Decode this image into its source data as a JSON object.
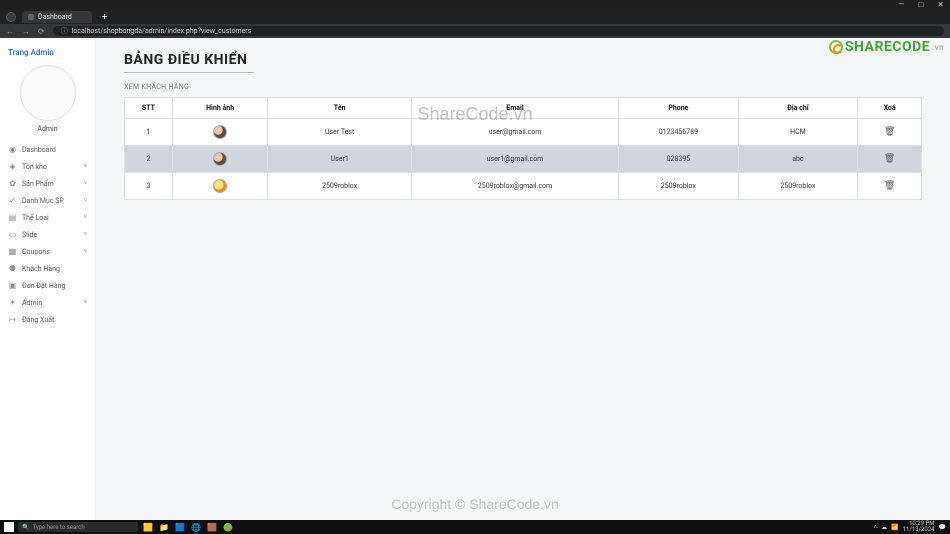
{
  "os": {
    "min": "—",
    "max": "□",
    "close": "✕"
  },
  "browser": {
    "tab_title": "Dashboard",
    "newtab": "+",
    "back": "←",
    "fwd": "→",
    "reload": "⟳",
    "url": "localhost/shopbongda/admin/index.php?view_customers"
  },
  "watermark": {
    "logo_text": "SHARECODE",
    "logo_suffix": ".vn",
    "center": "ShareCode.vn",
    "footer": "Copyright © ShareCode.vn"
  },
  "sidebar": {
    "brand": "Trang Admin",
    "admin_label": "Admin",
    "items": [
      {
        "icon": "◉",
        "label": "Dashboard",
        "chev": ""
      },
      {
        "icon": "◈",
        "label": "Tồn kho",
        "chev": "˅"
      },
      {
        "icon": "✿",
        "label": "Sản Phẩm",
        "chev": "˅"
      },
      {
        "icon": "✓",
        "label": "Danh Mục SP",
        "chev": "˅"
      },
      {
        "icon": "▤",
        "label": "Thể Loại",
        "chev": "˅"
      },
      {
        "icon": "▭",
        "label": "Slide",
        "chev": "˅"
      },
      {
        "icon": "▦",
        "label": "Coupons",
        "chev": "˅"
      },
      {
        "icon": "⚉",
        "label": "Khách Hàng",
        "chev": ""
      },
      {
        "icon": "▣",
        "label": "Đơn Đặt Hàng",
        "chev": ""
      },
      {
        "icon": "✶",
        "label": "Admin",
        "chev": "˅"
      },
      {
        "icon": "↦",
        "label": "Đăng Xuất",
        "chev": ""
      }
    ]
  },
  "page": {
    "title": "BẢNG ĐIỀU KHIỂN",
    "subtitle": "XEM KHÁCH HÀNG"
  },
  "table": {
    "headers": {
      "stt": "STT",
      "img": "Hình ảnh",
      "name": "Tên",
      "email": "Email",
      "phone": "Phone",
      "addr": "Địa chỉ",
      "del": "Xoá"
    },
    "rows": [
      {
        "stt": "1",
        "name": "User Test",
        "email": "user@gmail.com",
        "phone": "0123456789",
        "addr": "HCM",
        "avatar_class": ""
      },
      {
        "stt": "2",
        "name": "User1",
        "email": "user1@gmail.com",
        "phone": "028395",
        "addr": "abc",
        "avatar_class": ""
      },
      {
        "stt": "3",
        "name": "2509roblox",
        "email": "2509roblox@gmail.com",
        "phone": "2509roblox",
        "addr": "2509roblox",
        "avatar_class": "gold"
      }
    ],
    "del_icon": "🗑"
  },
  "taskbar": {
    "search_placeholder": "Type here to search",
    "time": "10:29 PM",
    "date": "11/13/2024"
  }
}
